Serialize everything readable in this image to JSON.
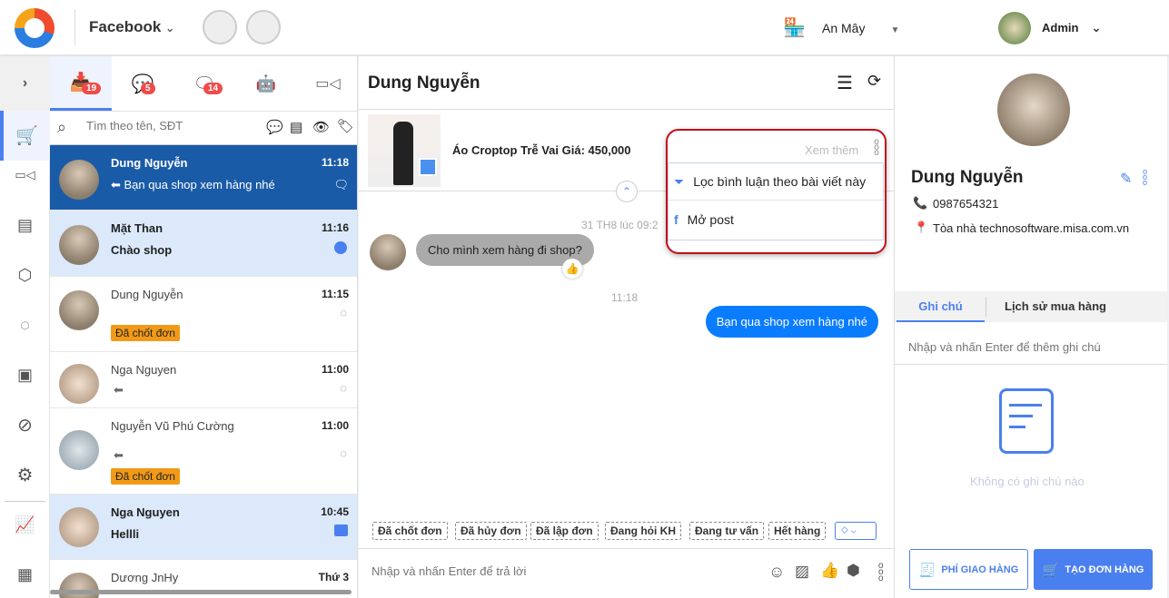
{
  "topbar": {
    "app": "Facebook",
    "shop": "An Mây",
    "user": "Admin"
  },
  "tabs": [
    {
      "icon": "inbox-icon",
      "badge": "19"
    },
    {
      "icon": "messenger-icon",
      "badge": "5"
    },
    {
      "icon": "comment-icon",
      "badge": "14"
    },
    {
      "icon": "bot-icon"
    },
    {
      "icon": "video-icon"
    }
  ],
  "search": {
    "placeholder": "Tìm theo tên, SĐT"
  },
  "conversations": [
    {
      "name": "Dung Nguyễn",
      "time": "11:18",
      "message": "Bạn qua shop xem hàng nhé"
    },
    {
      "name": "Mặt Than",
      "time": "11:16",
      "message": "Chào shop"
    },
    {
      "name": "Dung Nguyễn",
      "time": "11:15",
      "tag": "Đã chốt đơn"
    },
    {
      "name": "Nga Nguyen",
      "time": "11:00"
    },
    {
      "name": "Nguyễn Vũ Phú Cường",
      "time": "11:00",
      "tag": "Đã chốt đơn"
    },
    {
      "name": "Nga Nguyen",
      "time": "10:45",
      "message": "Hellli"
    },
    {
      "name": "Dương JnHy",
      "time": "Thứ 3"
    }
  ],
  "chat": {
    "title": "Dung Nguyễn",
    "post_title": "Áo Croptop Trễ Vai Giá: 450,000",
    "see_more": "Xem thêm",
    "menu": [
      "Lọc bình luận theo bài viết này",
      "Mở post"
    ],
    "date_label": "31 TH8 lúc 09:2",
    "incoming": "Cho mình xem hàng đi shop?",
    "time2": "11:18",
    "outgoing": "Bạn qua shop xem hàng nhé",
    "tags": [
      "Đã chốt đơn",
      "Đã hủy đơn",
      "Đã lập đơn",
      "Đang hỏi KH",
      "Đang tư vấn",
      "Hết hàng"
    ],
    "input_placeholder": "Nhập và nhấn Enter để trả lời"
  },
  "customer": {
    "name": "Dung Nguyễn",
    "phone": "0987654321",
    "address": "Tòa nhà technosoftware.misa.com.vn",
    "tabs": [
      "Ghi chú",
      "Lịch sử mua hàng"
    ],
    "note_placeholder": "Nhập và nhấn Enter để thêm ghi chú",
    "empty": "Không có ghi chú nào",
    "shipping_btn": "PHÍ GIAO HÀNG",
    "order_btn": "TẠO ĐƠN HÀNG"
  },
  "colors": {
    "accent": "#4a7ff0",
    "selected": "#1a5ba8",
    "highlight": "#dbe9fb",
    "tag": "#f29a17",
    "frame": "#c0101c"
  }
}
